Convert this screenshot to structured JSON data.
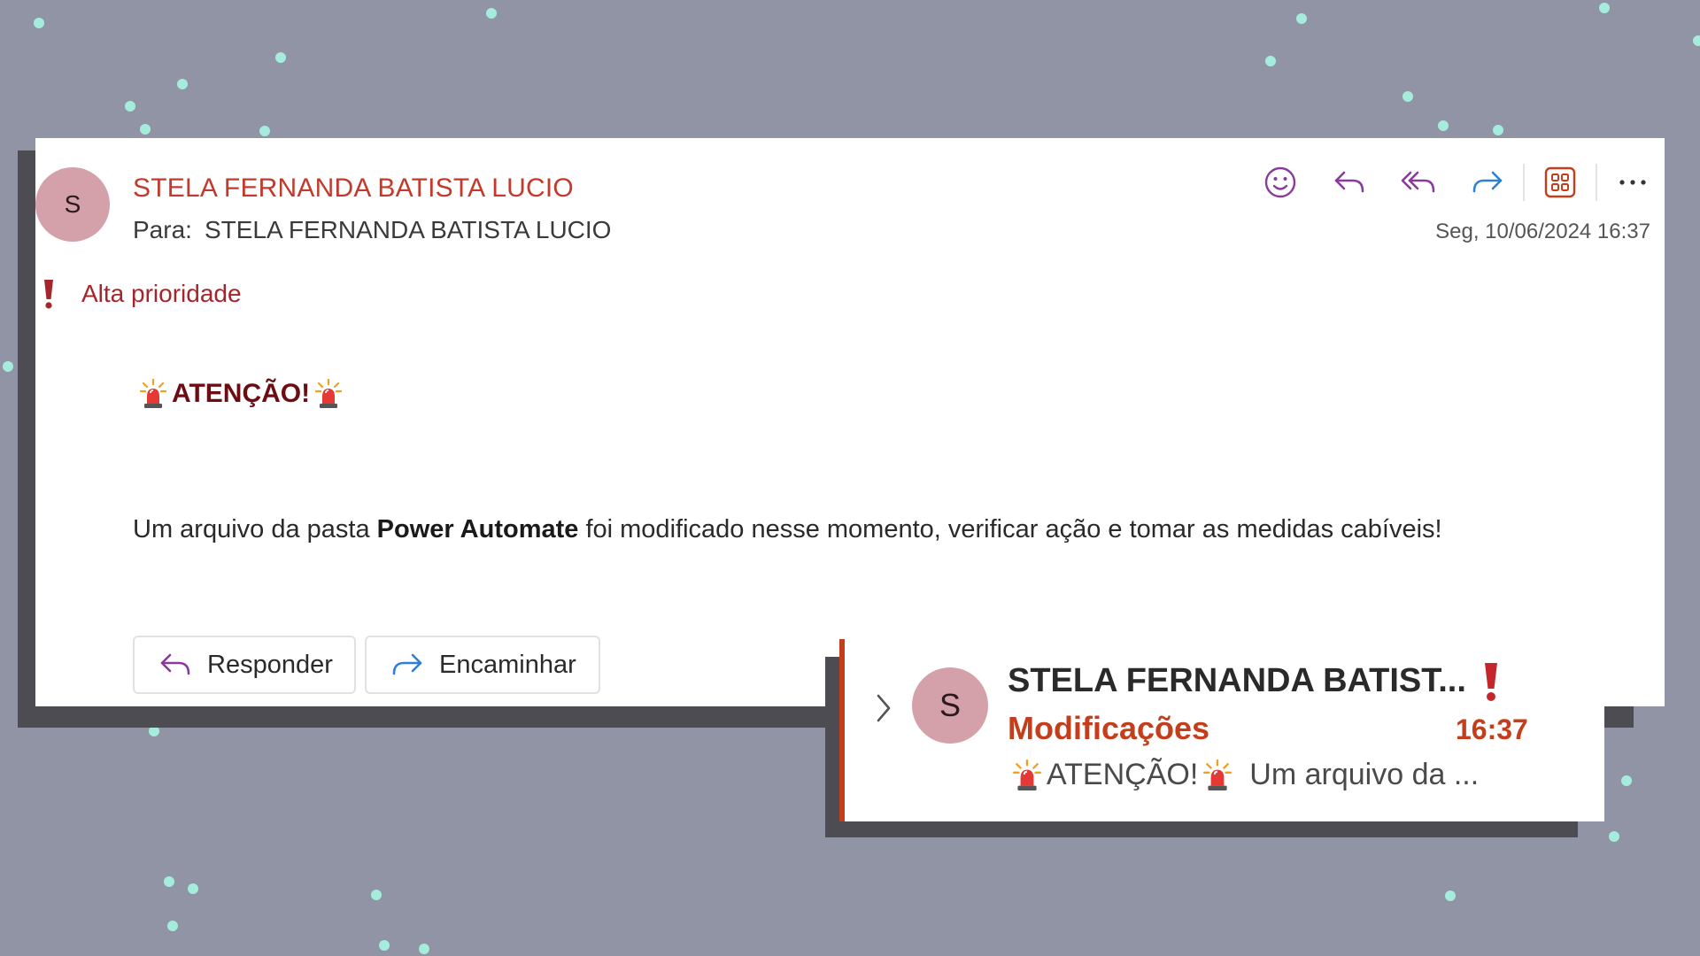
{
  "email": {
    "avatar_letter": "S",
    "sender": "STELA FERNANDA BATISTA LUCIO",
    "to_label": "Para:",
    "to_name": "STELA FERNANDA BATISTA LUCIO",
    "date": "Seg, 10/06/2024 16:37",
    "toolbar": [
      "emoji-react-icon",
      "reply-icon",
      "reply-all-icon",
      "forward-icon",
      "apps-icon",
      "more-icon"
    ],
    "priority_label": "Alta prioridade",
    "alert_title": "ATENÇÃO!",
    "body_pre": "Um arquivo da pasta ",
    "body_bold": "Power Automate",
    "body_post": " foi modificado nesse momento, verificar ação e tomar as medidas cabíveis!",
    "reply_label": "Responder",
    "forward_label": "Encaminhar"
  },
  "preview": {
    "avatar_letter": "S",
    "sender": "STELA FERNANDA BATIST...",
    "subject": "Modificações",
    "time": "16:37",
    "snippet_title": "ATENÇÃO!",
    "snippet_text": "Um arquivo da ..."
  },
  "colors": {
    "background": "#9094a4",
    "accent_red": "#c43e1c",
    "priority_red": "#a4262c",
    "toolbar_purple": "#8a3a9a",
    "toolbar_blue": "#2f7fd6",
    "avatar": "#d4a0aa",
    "dots": "#a6ecdc"
  }
}
